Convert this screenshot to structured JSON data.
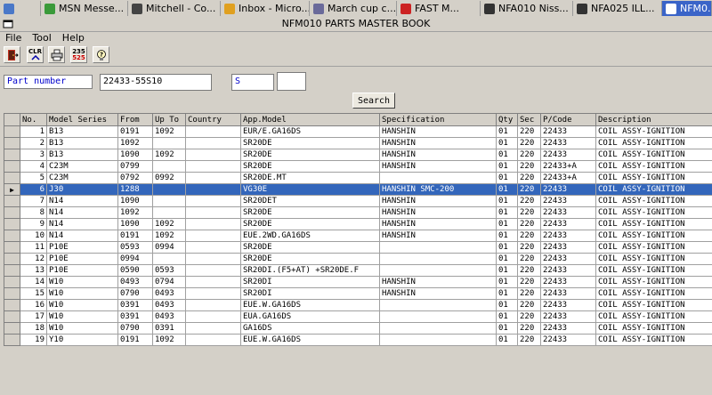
{
  "taskbar": {
    "items": [
      {
        "label": "",
        "icon": "apple-icon",
        "color": "#4a78c8"
      },
      {
        "label": "MSN Messe...",
        "icon": "msn-icon",
        "color": "#3a9a3a"
      },
      {
        "label": "Mitchell - Co...",
        "icon": "mitchell-icon",
        "color": "#444444"
      },
      {
        "label": "Inbox - Micro...",
        "icon": "outlook-icon",
        "color": "#e0a020"
      },
      {
        "label": "March cup c...",
        "icon": "document-icon",
        "color": "#6a6a9a"
      },
      {
        "label": "FAST M...",
        "icon": "fast-icon",
        "color": "#cc2222"
      },
      {
        "label": "NFA010 Niss...",
        "icon": "nfa-icon",
        "color": "#333333"
      },
      {
        "label": "NFA025 ILL...",
        "icon": "nfa-icon",
        "color": "#333333"
      },
      {
        "label": "NFM0...",
        "icon": "nfm-icon",
        "color": "#ffffff"
      }
    ]
  },
  "window": {
    "title": "NFM010 PARTS MASTER BOOK"
  },
  "menu": [
    "File",
    "Tool",
    "Help"
  ],
  "toolbar": {
    "buttons": [
      {
        "name": "exit-icon",
        "label": ""
      },
      {
        "name": "clear-icon",
        "label": "CLR"
      },
      {
        "name": "print-icon",
        "label": ""
      },
      {
        "name": "calc-icon",
        "label": "235 525"
      },
      {
        "name": "help-icon",
        "label": "?"
      }
    ]
  },
  "search": {
    "label": "Part number",
    "part_number": "22433-55S10",
    "code": "S",
    "extra": "",
    "button_label": "Search"
  },
  "grid": {
    "columns": [
      "No.",
      "Model Series",
      "From",
      "Up To",
      "Country",
      "App.Model",
      "Specification",
      "Qty",
      "Sec",
      "P/Code",
      "Description"
    ],
    "selected_index": 5,
    "rows": [
      [
        "1",
        "B13",
        "0191",
        "1092",
        "",
        "EUR/E.GA16DS",
        "HANSHIN",
        "01",
        "220",
        "22433",
        "COIL ASSY-IGNITION"
      ],
      [
        "2",
        "B13",
        "1092",
        "",
        "",
        "SR20DE",
        "HANSHIN",
        "01",
        "220",
        "22433",
        "COIL ASSY-IGNITION"
      ],
      [
        "3",
        "B13",
        "1090",
        "1092",
        "",
        "SR20DE",
        "HANSHIN",
        "01",
        "220",
        "22433",
        "COIL ASSY-IGNITION"
      ],
      [
        "4",
        "C23M",
        "0799",
        "",
        "",
        "SR20DE",
        "HANSHIN",
        "01",
        "220",
        "22433+A",
        "COIL ASSY-IGNITION"
      ],
      [
        "5",
        "C23M",
        "0792",
        "0992",
        "",
        "SR20DE.MT",
        "",
        "01",
        "220",
        "22433+A",
        "COIL ASSY-IGNITION"
      ],
      [
        "6",
        "J30",
        "1288",
        "",
        "",
        "VG30E",
        "HANSHIN SMC-200",
        "01",
        "220",
        "22433",
        "COIL ASSY-IGNITION"
      ],
      [
        "7",
        "N14",
        "1090",
        "",
        "",
        "SR20DET",
        "HANSHIN",
        "01",
        "220",
        "22433",
        "COIL ASSY-IGNITION"
      ],
      [
        "8",
        "N14",
        "1092",
        "",
        "",
        "SR20DE",
        "HANSHIN",
        "01",
        "220",
        "22433",
        "COIL ASSY-IGNITION"
      ],
      [
        "9",
        "N14",
        "1090",
        "1092",
        "",
        "SR20DE",
        "HANSHIN",
        "01",
        "220",
        "22433",
        "COIL ASSY-IGNITION"
      ],
      [
        "10",
        "N14",
        "0191",
        "1092",
        "",
        "EUE.2WD.GA16DS",
        "HANSHIN",
        "01",
        "220",
        "22433",
        "COIL ASSY-IGNITION"
      ],
      [
        "11",
        "P10E",
        "0593",
        "0994",
        "",
        "SR20DE",
        "",
        "01",
        "220",
        "22433",
        "COIL ASSY-IGNITION"
      ],
      [
        "12",
        "P10E",
        "0994",
        "",
        "",
        "SR20DE",
        "",
        "01",
        "220",
        "22433",
        "COIL ASSY-IGNITION"
      ],
      [
        "13",
        "P10E",
        "0590",
        "0593",
        "",
        "SR20DI.(F5+AT) +SR20DE.F",
        "",
        "01",
        "220",
        "22433",
        "COIL ASSY-IGNITION"
      ],
      [
        "14",
        "W10",
        "0493",
        "0794",
        "",
        "SR20DI",
        "HANSHIN",
        "01",
        "220",
        "22433",
        "COIL ASSY-IGNITION"
      ],
      [
        "15",
        "W10",
        "0790",
        "0493",
        "",
        "SR20DI",
        "HANSHIN",
        "01",
        "220",
        "22433",
        "COIL ASSY-IGNITION"
      ],
      [
        "16",
        "W10",
        "0391",
        "0493",
        "",
        "EUE.W.GA16DS",
        "",
        "01",
        "220",
        "22433",
        "COIL ASSY-IGNITION"
      ],
      [
        "17",
        "W10",
        "0391",
        "0493",
        "",
        "EUA.GA16DS",
        "",
        "01",
        "220",
        "22433",
        "COIL ASSY-IGNITION"
      ],
      [
        "18",
        "W10",
        "0790",
        "0391",
        "",
        "GA16DS",
        "",
        "01",
        "220",
        "22433",
        "COIL ASSY-IGNITION"
      ],
      [
        "19",
        "Y10",
        "0191",
        "1092",
        "",
        "EUE.W.GA16DS",
        "",
        "01",
        "220",
        "22433",
        "COIL ASSY-IGNITION"
      ]
    ]
  }
}
